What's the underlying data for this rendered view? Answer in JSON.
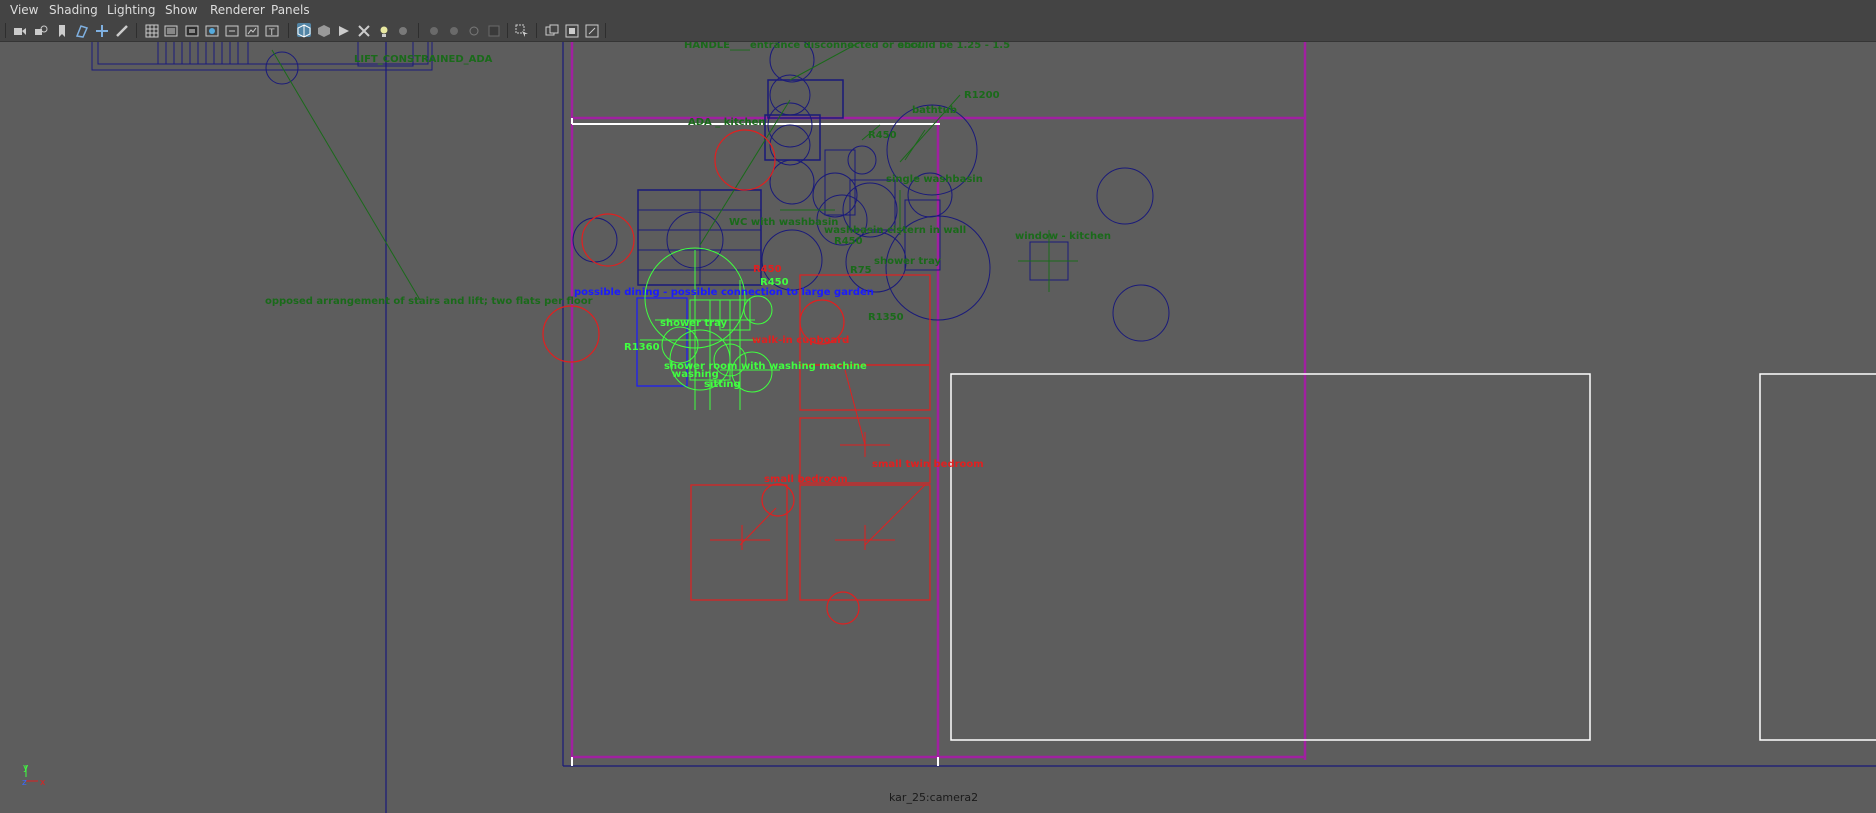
{
  "menu": {
    "view": "View",
    "shading": "Shading",
    "lighting": "Lighting",
    "show": "Show",
    "renderer": "Renderer",
    "panels": "Panels"
  },
  "toolbar": {
    "icons": [
      "camera-icon",
      "camera-attributes-icon",
      "bookmark-icon",
      "image-plane-icon",
      "2d-pan-zoom-icon",
      "grease-pencil-icon",
      "grid-icon",
      "film-gate-icon",
      "resolution-gate-icon",
      "gate-mask-icon",
      "field-chart-icon",
      "safe-action-icon",
      "safe-title-icon",
      "wireframe-icon",
      "smooth-shade-icon",
      "use-default-material-icon",
      "xray-icon",
      "lights-icon",
      "shadows-icon",
      "ambient-occlusion-icon",
      "motion-blur-icon",
      "anti-alias-icon",
      "depth-of-field-icon",
      "isolate-select-icon",
      "frame-all-icon",
      "frame-selection-icon",
      "toggle-hud-icon"
    ],
    "active": [
      "wireframe-icon"
    ]
  },
  "viewport": {
    "camera_label": "kar_25:camera2",
    "axis": {
      "y": "y",
      "z": "z",
      "x": "x"
    },
    "annotations": {
      "lift_constrained": "LIFT_CONSTRAINED_ADA",
      "handle": "HANDLE____entrance disconnected or ecc?",
      "should_be": "should be 1.25 - 1.5",
      "ada_kitchen": "ADA _ kitchen",
      "bathtub": "bathtub",
      "r1200": "R1200",
      "r450_a": "R450",
      "single_washbasin": "single washbasin",
      "wc_with_washbasin": "WC with washbasin",
      "washbasin_in_wall": "washbasin cistern in wall",
      "window_kitchen": "window - kitchen",
      "r450_b": "R450",
      "shower_tray_a": "shower tray",
      "opposed": "opposed arrangement of stairs and lift; two flats per floor",
      "r450_c": "R450",
      "possible_dining": "possible dining - possible connection to large garden",
      "r1350_a": "R1350",
      "walk_in_cupboard": "walk-in cupboard",
      "shower_tray_b": "shower tray",
      "r1360": "R1360",
      "shower_room": "shower room with washing machine",
      "washing": "washing",
      "sitting": "sitting",
      "r450_d": "R450",
      "small_twin_bedroom": "small twin bedroom",
      "small_bedroom": "small bedroom",
      "r75": "R75"
    }
  },
  "colors": {
    "background": "#5d5d5d",
    "menubar": "#444444",
    "dark_green": "#1a6a1a",
    "navy": "#1a1a7a",
    "red": "#e02020",
    "bright_green": "#40ff40",
    "blue": "#1a1aff",
    "magenta": "#a020a0",
    "white": "#ffffff",
    "active_tool": "#5285a6"
  }
}
